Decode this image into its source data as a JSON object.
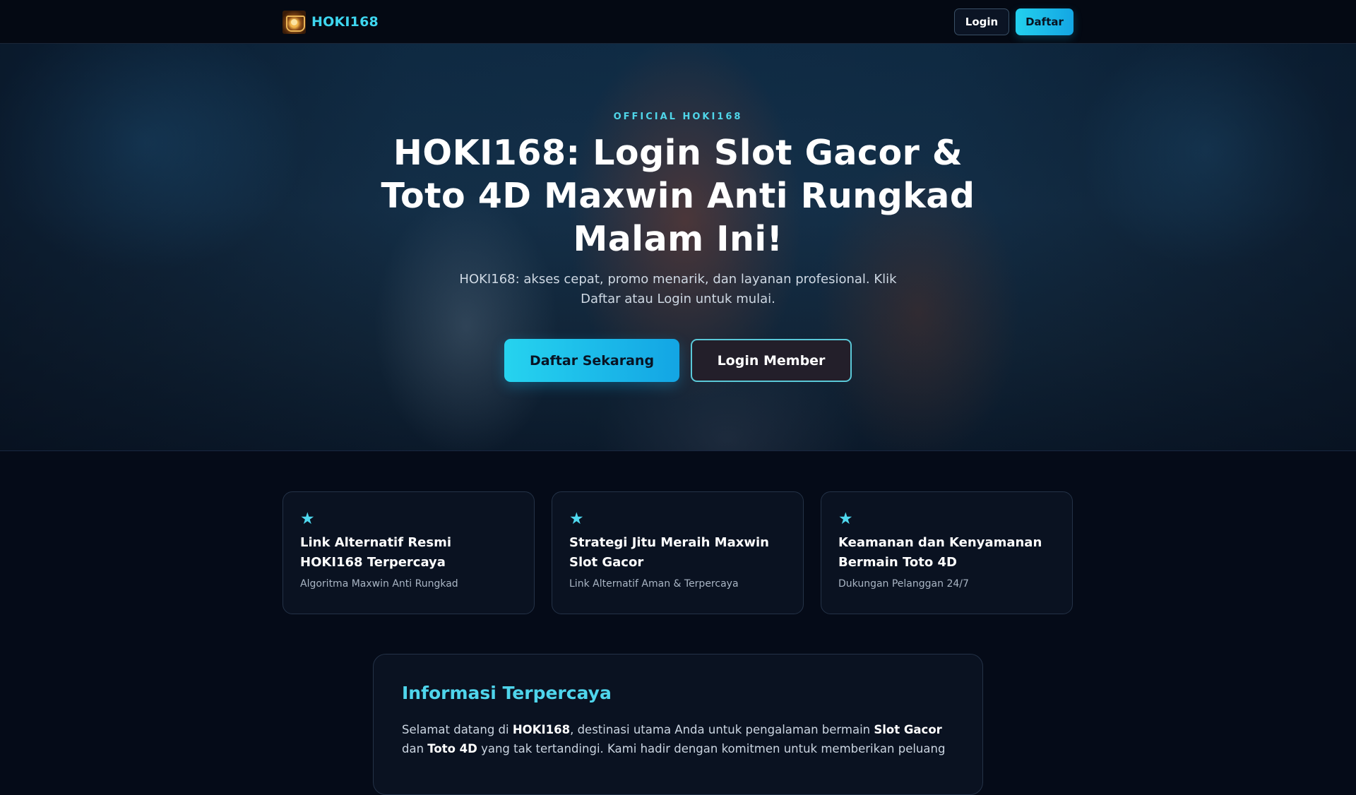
{
  "colors": {
    "accent": "#3ed6ef",
    "background": "#050b18",
    "card_background": "#0a1221",
    "primary_button": "#1fbfeb"
  },
  "navbar": {
    "logo_icon": "hoki168-logo",
    "brand": "HOKI168",
    "login_label": "Login",
    "register_label": "Daftar"
  },
  "hero": {
    "eyebrow": "OFFICIAL HOKI168",
    "title": "HOKI168: Login Slot Gacor & Toto 4D Maxwin Anti Rungkad Malam Ini!",
    "subtitle": "HOKI168: akses cepat, promo menarik, dan layanan profesional. Klik Daftar atau Login untuk mulai.",
    "primary_button": "Daftar Sekarang",
    "secondary_button": "Login Member"
  },
  "features": [
    {
      "icon": "star-icon",
      "symbol": "★",
      "title": "Link Alternatif Resmi HOKI168 Terpercaya",
      "subtitle": "Algoritma Maxwin Anti Rungkad"
    },
    {
      "icon": "star-icon",
      "symbol": "★",
      "title": "Strategi Jitu Meraih Maxwin Slot Gacor",
      "subtitle": "Link Alternatif Aman & Terpercaya"
    },
    {
      "icon": "star-icon",
      "symbol": "★",
      "title": "Keamanan dan Kenyamanan Bermain Toto 4D",
      "subtitle": "Dukungan Pelanggan 24/7"
    }
  ],
  "info": {
    "title": "Informasi Terpercaya",
    "p1_text1": "Selamat datang di ",
    "p1_bold1": "HOKI168",
    "p1_text2": ", destinasi utama Anda untuk pengalaman bermain ",
    "p1_bold2": "Slot Gacor",
    "p1_text3": " dan ",
    "p1_bold3": "Toto 4D",
    "p1_text4": " yang tak tertandingi. Kami hadir dengan komitmen untuk memberikan peluang"
  }
}
